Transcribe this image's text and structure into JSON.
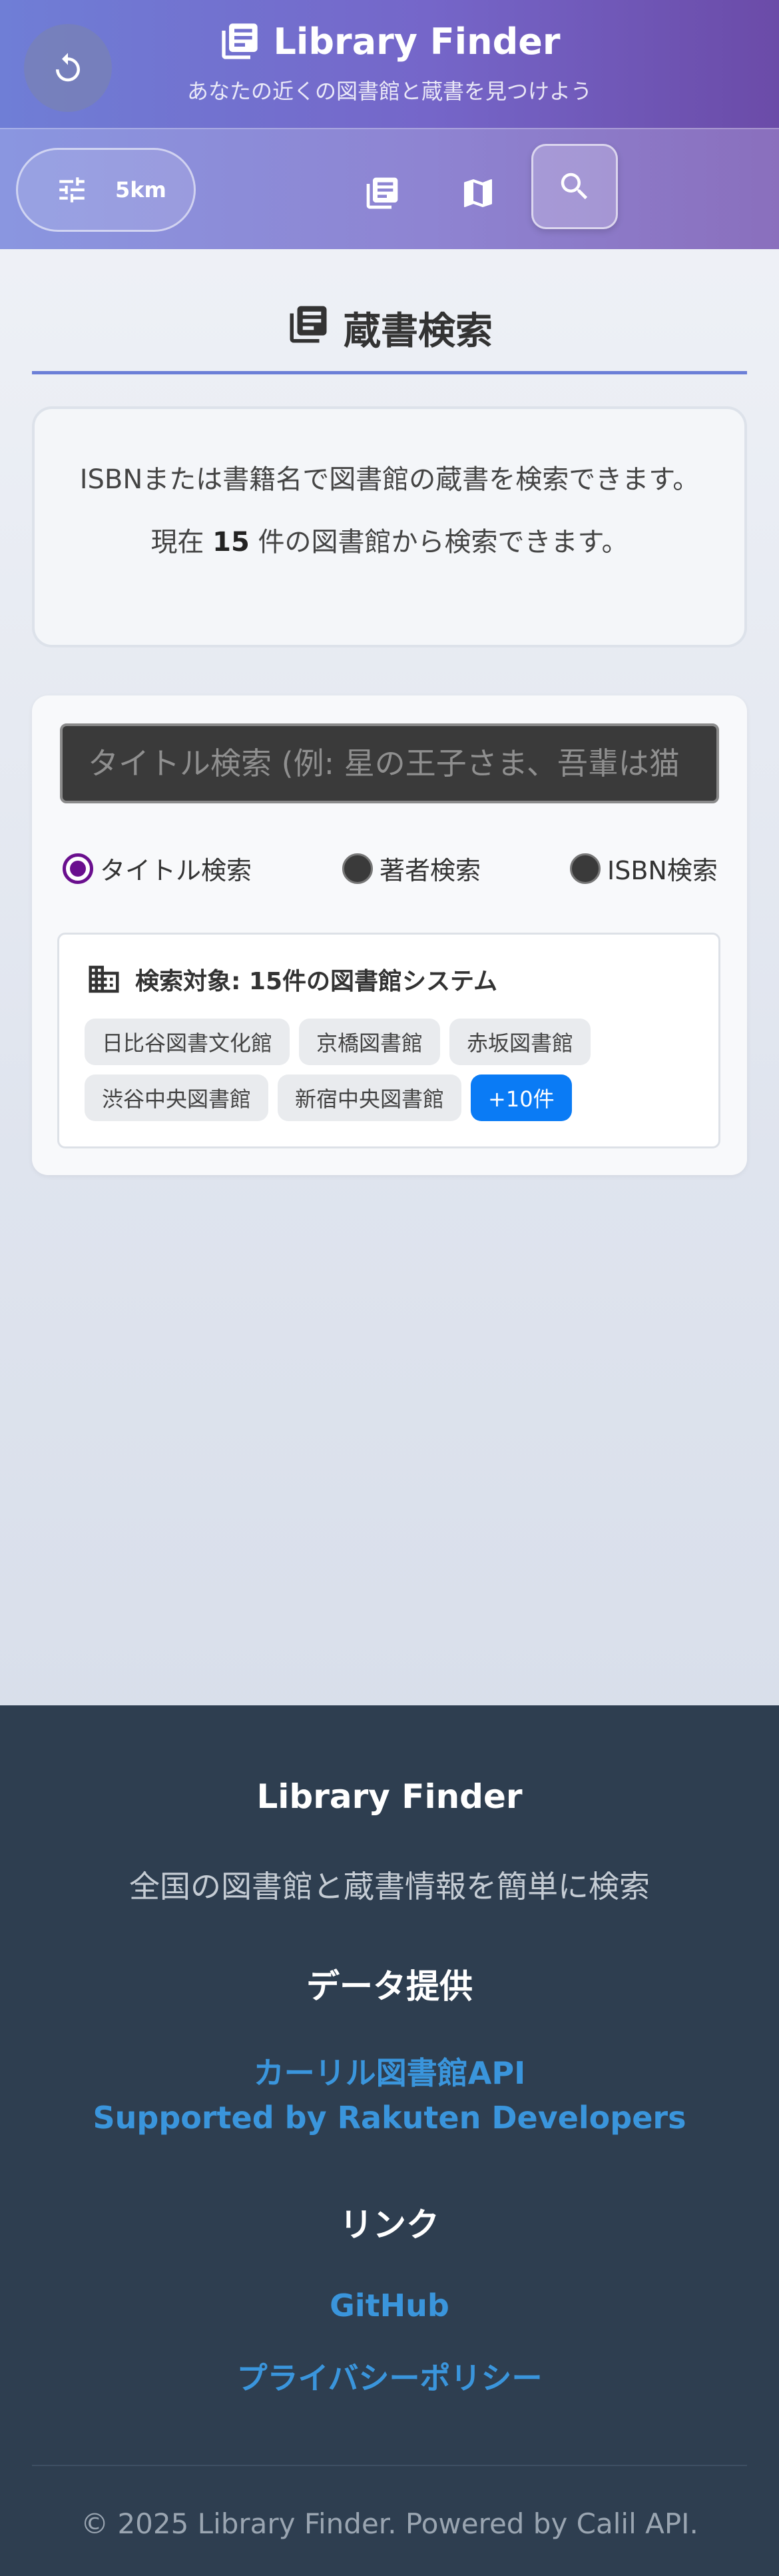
{
  "app": {
    "title": "Library Finder",
    "subtitle": "あなたの近くの図書館と蔵書を見つけよう"
  },
  "toolbar": {
    "radius_label": "5km"
  },
  "section": {
    "title": "蔵書検索"
  },
  "info": {
    "line1": "ISBNまたは書籍名で図書館の蔵書を検索できます。",
    "line2_prefix": "現在 ",
    "line2_count": "15",
    "line2_suffix": " 件の図書館から検索できます。"
  },
  "search": {
    "placeholder": "タイトル検索 (例: 星の王子さま、吾輩は猫",
    "modes": [
      {
        "label": "タイトル検索",
        "selected": true
      },
      {
        "label": "著者検索",
        "selected": false
      },
      {
        "label": "ISBN検索",
        "selected": false
      }
    ],
    "target_label": "検索対象: 15件の図書館システム",
    "libraries": [
      "日比谷図書文化館",
      "京橋図書館",
      "赤坂図書館",
      "渋谷中央図書館",
      "新宿中央図書館"
    ],
    "more_label": "+10件"
  },
  "footer": {
    "title": "Library Finder",
    "tagline": "全国の図書館と蔵書情報を簡単に検索",
    "data_heading": "データ提供",
    "data_links": [
      "カーリル図書館API",
      "Supported by Rakuten Developers"
    ],
    "links_heading": "リンク",
    "links": [
      "GitHub",
      "プライバシーポリシー"
    ],
    "copyright": "© 2025 Library Finder. Powered by Calil API."
  },
  "colors": {
    "header_start": "#6f7ed6",
    "header_end": "#6b4ba8",
    "accent": "#6b7fd7",
    "radio_selected": "#6a0f8e",
    "chip_more": "#0a7bf5",
    "footer_bg": "#2e3e50",
    "footer_link": "#3a95dc"
  },
  "icons": [
    "refresh-icon",
    "library-books-icon",
    "sliders-icon",
    "book-list-icon",
    "map-icon",
    "search-icon",
    "building-icon"
  ]
}
